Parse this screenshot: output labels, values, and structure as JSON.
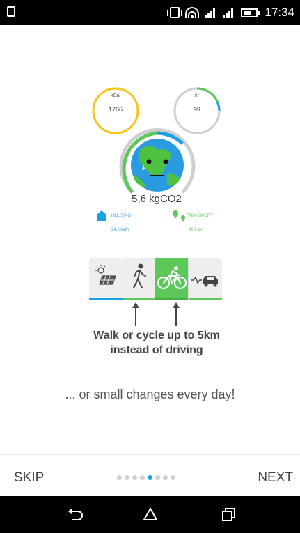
{
  "status_bar": {
    "time": "17:34",
    "icons": [
      "screen-icon",
      "vibrate-icon",
      "wifi-icon",
      "signal-icon",
      "signal-icon",
      "battery-icon"
    ]
  },
  "illustration": {
    "gauge_left": {
      "label": "kCal",
      "value": "1766"
    },
    "gauge_right": {
      "label": "kr",
      "value": "99"
    },
    "center_value": "5,6 kgCO2",
    "legend": [
      {
        "title": "HOUSING",
        "value": "24,6 kWh",
        "icon": "house-icon"
      },
      {
        "title": "TRANSPORT",
        "value": "40,2 km",
        "icon": "location-pin-icon"
      }
    ],
    "tiles": [
      {
        "name": "solar-panel",
        "icon": "solar-panel-icon"
      },
      {
        "name": "walk",
        "icon": "walking-person-icon"
      },
      {
        "name": "bicycle",
        "icon": "bicycle-icon",
        "selected": true
      },
      {
        "name": "electric-car",
        "icon": "electric-car-icon"
      }
    ],
    "caption_line1": "Walk or cycle up to 5km",
    "caption_line2": "instead of driving",
    "colors": {
      "blue": "#1aa1e1",
      "green": "#5cc85a",
      "yellow": "#f5c518"
    }
  },
  "subtitle": "... or small changes every day!",
  "footer": {
    "skip_label": "SKIP",
    "next_label": "NEXT",
    "page_count": 8,
    "active_page": 5
  },
  "nav_bar": {
    "buttons": [
      "back-icon",
      "home-icon",
      "recents-icon"
    ]
  }
}
